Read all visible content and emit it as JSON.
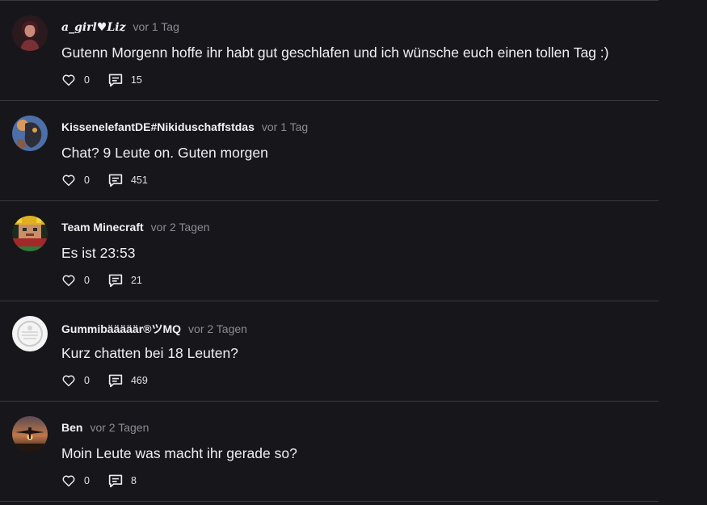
{
  "comments": [
    {
      "author": "a_girl♥Liz",
      "time": "vor 1 Tag",
      "text": "Gutenn Morgenn hoffe ihr habt gut geschlafen und ich wünsche euch einen tollen Tag :)",
      "likes": "0",
      "replies": "15"
    },
    {
      "author": "KissenelefantDE#Nikiduschaffstdas",
      "time": "vor 1 Tag",
      "text": "Chat? 9 Leute on. Guten morgen",
      "likes": "0",
      "replies": "451"
    },
    {
      "author": "Team Minecraft",
      "time": "vor 2 Tagen",
      "text": "Es ist 23:53",
      "likes": "0",
      "replies": "21"
    },
    {
      "author": "Gummibääääär®ツMQ",
      "time": "vor 2 Tagen",
      "text": "Kurz chatten bei 18 Leuten?",
      "likes": "0",
      "replies": "469"
    },
    {
      "author": "Ben",
      "time": "vor 2 Tagen",
      "text": "Moin Leute was macht ihr gerade so?",
      "likes": "0",
      "replies": "8"
    }
  ],
  "icons": {
    "like": "heart-outline-icon",
    "reply": "comment-bubble-icon"
  },
  "colors": {
    "background": "#17171b",
    "separator": "#3a3a40",
    "timestamp": "#8b8b93"
  }
}
